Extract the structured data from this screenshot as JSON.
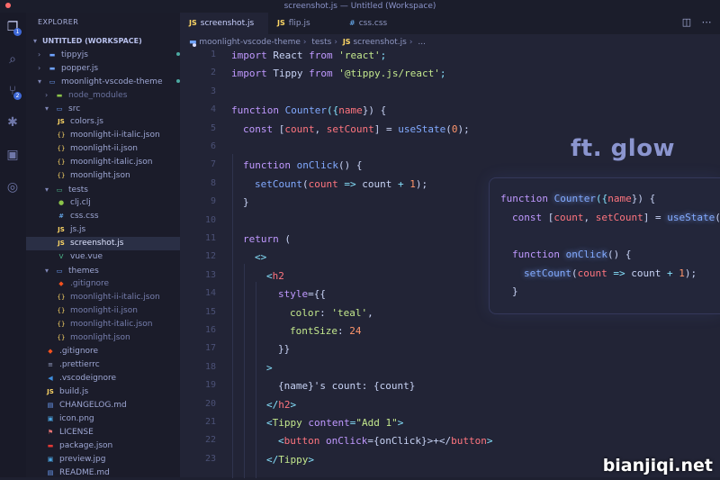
{
  "window": {
    "title": "screenshot.js — Untitled (Workspace)"
  },
  "activity": {
    "explorer_badge": "1",
    "scm_badge": "2"
  },
  "sidebar": {
    "title": "EXPLORER",
    "workspace": "UNTITLED (WORKSPACE)",
    "items": [
      {
        "label": "tippyjs"
      },
      {
        "label": "popper.js"
      },
      {
        "label": "moonlight-vscode-theme"
      },
      {
        "label": "node_modules"
      },
      {
        "label": "src"
      },
      {
        "label": "colors.js"
      },
      {
        "label": "moonlight-ii-italic.json"
      },
      {
        "label": "moonlight-ii.json"
      },
      {
        "label": "moonlight-italic.json"
      },
      {
        "label": "moonlight.json"
      },
      {
        "label": "tests"
      },
      {
        "label": "clj.clj"
      },
      {
        "label": "css.css"
      },
      {
        "label": "js.js"
      },
      {
        "label": "screenshot.js",
        "status": "U"
      },
      {
        "label": "vue.vue"
      },
      {
        "label": "themes"
      },
      {
        "label": ".gitignore"
      },
      {
        "label": "moonlight-ii-italic.json"
      },
      {
        "label": "moonlight-ii.json"
      },
      {
        "label": "moonlight-italic.json"
      },
      {
        "label": "moonlight.json"
      },
      {
        "label": ".gitignore"
      },
      {
        "label": ".prettierrc"
      },
      {
        "label": ".vscodeignore"
      },
      {
        "label": "build.js"
      },
      {
        "label": "CHANGELOG.md"
      },
      {
        "label": "icon.png"
      },
      {
        "label": "LICENSE"
      },
      {
        "label": "package.json"
      },
      {
        "label": "preview.jpg"
      },
      {
        "label": "README.md"
      }
    ]
  },
  "tabs": [
    {
      "label": "screenshot.js",
      "icon": "JS"
    },
    {
      "label": "flip.js",
      "icon": "JS"
    },
    {
      "label": "css.css",
      "icon": "#"
    }
  ],
  "breadcrumb": [
    "moonlight-vscode-theme",
    "tests",
    "screenshot.js",
    "..."
  ],
  "line_numbers": [
    "1",
    "2",
    "3",
    "4",
    "5",
    "6",
    "7",
    "8",
    "9",
    "10",
    "11",
    "12",
    "13",
    "14",
    "15",
    "16",
    "17",
    "18",
    "19",
    "20",
    "21",
    "22",
    "23"
  ],
  "code": {
    "l1": {
      "a": "import",
      "b": " React ",
      "c": "from",
      "d": " 'react'",
      "e": ";"
    },
    "l2": {
      "a": "import",
      "b": " Tippy ",
      "c": "from",
      "d": " '@tippy.js/react'",
      "e": ";"
    },
    "l4": {
      "a": "function",
      "b": " Counter",
      "c": "({",
      "d": "name",
      "e": "}) {"
    },
    "l5": {
      "a": "const",
      "b": " [",
      "c": "count",
      "d": ", ",
      "e": "setCount",
      "f": "] = ",
      "g": "useState",
      "h": "(",
      "i": "0",
      "j": ");"
    },
    "l7": {
      "a": "function",
      "b": " onClick",
      "c": "() {"
    },
    "l8": {
      "a": "setCount",
      "b": "(",
      "c": "count",
      "d": " => ",
      "e": "count",
      "f": " + ",
      "g": "1",
      "h": ");"
    },
    "l9": {
      "a": "}"
    },
    "l11": {
      "a": "return",
      "b": " ("
    },
    "l12": {
      "a": "<>"
    },
    "l13": {
      "a": "<",
      "b": "h2"
    },
    "l14": {
      "a": "style",
      "b": "={{"
    },
    "l15": {
      "a": "color",
      "b": ": ",
      "c": "'teal'",
      "d": ","
    },
    "l16": {
      "a": "fontSize",
      "b": ": ",
      "c": "24"
    },
    "l17": {
      "a": "}}"
    },
    "l18": {
      "a": ">"
    },
    "l19": {
      "a": "{name}'s count: {count}"
    },
    "l20": {
      "a": "</",
      "b": "h2",
      "c": ">"
    },
    "l21": {
      "a": "<",
      "b": "Tippy",
      "c": " content",
      "d": "=",
      "e": "\"Add 1\"",
      "f": ">"
    },
    "l22": {
      "a": "<",
      "b": "button",
      "c": " onClick",
      "d": "={onClick}>+</",
      "e": "button",
      "f": ">"
    },
    "l23": {
      "a": "</",
      "b": "Tippy",
      "c": ">"
    }
  },
  "glow": {
    "title": "ft. glow",
    "g1": {
      "a": "function",
      "b": " Counter",
      "c": "({",
      "d": "name",
      "e": "}) {"
    },
    "g2": {
      "a": "const",
      "b": " [",
      "c": "count",
      "d": ", ",
      "e": "setCount",
      "f": "] = ",
      "g": "useState",
      "h": "(0"
    },
    "g4": {
      "a": "function",
      "b": " onClick",
      "c": "() {"
    },
    "g5": {
      "a": "setCount",
      "b": "(",
      "c": "count",
      "d": " => ",
      "e": "count",
      "f": " + ",
      "g": "1",
      "h": ");"
    },
    "g6": {
      "a": "}"
    }
  },
  "watermark": "bianjiqi.net"
}
